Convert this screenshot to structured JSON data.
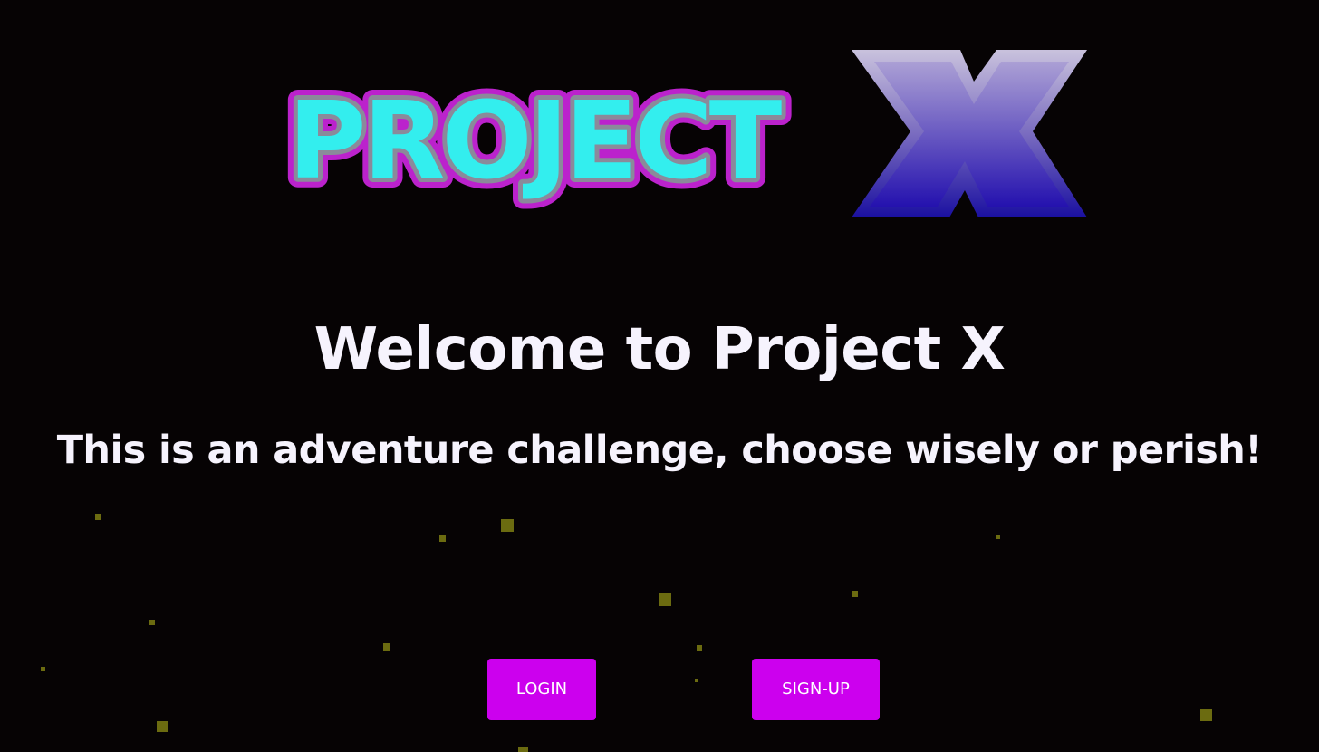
{
  "logo": {
    "wordmark": "PROJECT",
    "accent_letter": "X"
  },
  "hero": {
    "title": "Welcome to Project X",
    "subtitle": "This is an adventure challenge, choose wisely or perish!"
  },
  "actions": {
    "login_label": "LOGIN",
    "signup_label": "SIGN-UP"
  },
  "colors": {
    "background": "#060304",
    "button": "#cc00ee",
    "logo_fill": "#33eeee",
    "logo_outline": "#bb22cc",
    "x_fill": "#2a1aa8",
    "particle": "#6b6b10"
  }
}
